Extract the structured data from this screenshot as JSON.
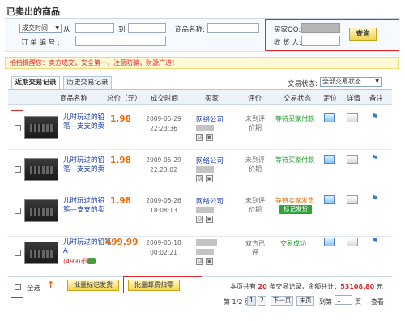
{
  "page": {
    "title": "已卖出的商品"
  },
  "search": {
    "time_select": "成交时间",
    "from_label": "从",
    "to_label": "到",
    "product_label": "商品名称:",
    "order_label": "订 单 编 号 :",
    "buyer_qq_label": "买家QQ:",
    "receiver_label": "收 货 人:",
    "query_button": "查询"
  },
  "notice": "拍拍提醒您：卖方成交，安全第一，注意防骗，财源广进！",
  "tabs": [
    {
      "label": "近期交易记录",
      "active": true
    },
    {
      "label": "历史交易记录",
      "active": false
    }
  ],
  "status_filter": {
    "label": "交易状态:",
    "value": "全部交易状态"
  },
  "table": {
    "headers": [
      "商品名称",
      "总价（元）",
      "成交时间",
      "买家",
      "评价",
      "交易状态",
      "定位",
      "详情",
      "备注"
    ],
    "rows": [
      {
        "name": "儿时玩过的铅笔—支支的卖",
        "price": "1.98",
        "date": "2009-05-29",
        "time": "22:23:36",
        "buyer": "网络公司",
        "eval": "未到评价期",
        "status": "等待买家付款",
        "action": ""
      },
      {
        "name": "儿时玩过的铅笔—支支的卖",
        "price": "1.98",
        "date": "2009-05-29",
        "time": "22:23:02",
        "buyer": "网络公司",
        "eval": "未到评价期",
        "status": "等待买家付款",
        "action": ""
      },
      {
        "name": "儿时玩过的铅笔—支支的卖",
        "price": "1.98",
        "date": "2009-05-26",
        "time": "18:08:13",
        "buyer": "网络公司",
        "eval": "未到评价期",
        "status": "等待卖家发货",
        "action": "标记发货"
      },
      {
        "name": "儿时玩过的铅笔A",
        "extra": "(499)币",
        "price": "499.99",
        "date": "2009-05-18",
        "time": "00:02:21",
        "buyer": "",
        "eval": "双方已评",
        "status": "交易成功",
        "action": ""
      }
    ]
  },
  "footer": {
    "select_all": "全选",
    "batch_ship": "批量标记发货",
    "batch_return": "批量邮费归零",
    "summary_prefix": "本页共有",
    "summary_count": "20",
    "summary_mid": "条交易记录，金额共计：",
    "summary_amount": "53108.80",
    "summary_suffix": "元",
    "page_label": "第 1/2 页",
    "page_1": "1",
    "page_2": "2",
    "prev_page": "下一页",
    "last_page": "末页",
    "goto_label": "到第",
    "goto_value": "1",
    "page_unit": "页",
    "view_button": "查看"
  },
  "colors": {
    "accent_red": "#e0282b",
    "price_orange": "#e46c0a",
    "link_blue": "#1a3fa8",
    "success_green": "#1f9a2b"
  }
}
